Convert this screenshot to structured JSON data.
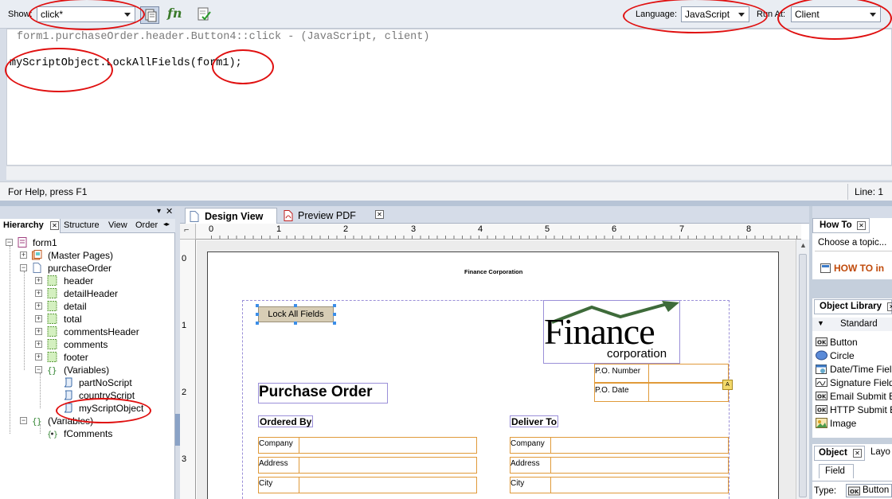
{
  "toolbar": {
    "show_label": "Show:",
    "show_value": "click*",
    "fn_label": "fn",
    "language_label": "Language:",
    "language_value": "JavaScript",
    "runat_label": "Run At:",
    "runat_value": "Client"
  },
  "script_editor": {
    "header": "form1.purchaseOrder.header.Button4::click - (JavaScript, client)",
    "code_obj": "myScriptObject",
    "code_method": ".LockAllFields(",
    "code_arg": "form1",
    "code_end": ");"
  },
  "status_bar": {
    "help": "For Help, press F1",
    "line": "Line: 1"
  },
  "hierarchy": {
    "tabs": [
      "Hierarchy",
      "Structure",
      "View",
      "Order"
    ],
    "tree": [
      {
        "label": "form1"
      },
      {
        "label": "(Master Pages)"
      },
      {
        "label": "purchaseOrder"
      },
      {
        "label": "header"
      },
      {
        "label": "detailHeader"
      },
      {
        "label": "detail"
      },
      {
        "label": "total"
      },
      {
        "label": "commentsHeader"
      },
      {
        "label": "comments"
      },
      {
        "label": "footer"
      },
      {
        "label": "(Variables)"
      },
      {
        "label": "partNoScript"
      },
      {
        "label": "countryScript"
      },
      {
        "label": "myScriptObject"
      },
      {
        "label": "(Variables)"
      },
      {
        "label": "fComments"
      }
    ]
  },
  "design": {
    "tabs": [
      "Design View",
      "Preview PDF"
    ],
    "ruler_h": [
      "0",
      "1",
      "2",
      "3",
      "4",
      "5",
      "6",
      "7",
      "8"
    ],
    "ruler_v": [
      "0",
      "1",
      "2",
      "3"
    ],
    "page": {
      "company_header": "Finance Corporation",
      "button_label": "Lock All Fields",
      "logo_main": "Finance",
      "logo_sub": "corporation",
      "po_number": "P.O. Number",
      "po_date": "P.O. Date",
      "title": "Purchase Order",
      "ordered_by": "Ordered By",
      "deliver_to": "Deliver To",
      "fields": [
        "Company",
        "Address",
        "City"
      ]
    }
  },
  "right_panels": {
    "howto_tab": "How To",
    "howto_select": "Choose a topic...",
    "howto_link": "HOW TO in",
    "library_tab": "Object Library",
    "library_group": "Standard",
    "library_items": [
      "Button",
      "Circle",
      "Date/Time Field",
      "Signature Field",
      "Email Submit Bu",
      "HTTP Submit Bu",
      "Image"
    ],
    "object_tab": "Object",
    "layout_tab": "Layo",
    "field_tab": "Field",
    "type_label": "Type:",
    "type_value": "Button"
  }
}
